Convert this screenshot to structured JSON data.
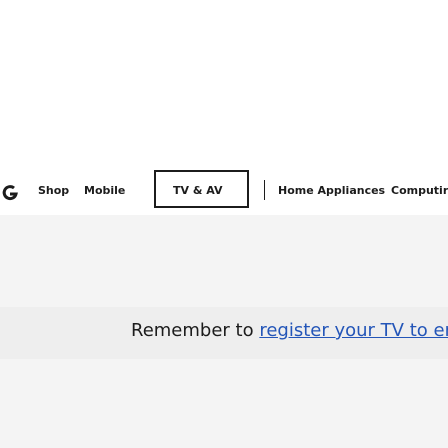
{
  "nav": {
    "logo_icon": "g-logo-icon",
    "items": [
      {
        "label": "Shop",
        "selected": false
      },
      {
        "label": "Mobile",
        "selected": false
      },
      {
        "label": "TV & AV",
        "selected": true
      },
      {
        "label": "Home Appliances",
        "selected": false
      },
      {
        "label": "Computir",
        "selected": false
      }
    ]
  },
  "reminder": {
    "prefix": "Remember to ",
    "link_text": "register your TV to enj"
  },
  "colors": {
    "text": "#1c1c1c",
    "link": "#2355b8",
    "lower_background": "#f4f4f4",
    "reminder_background": "#eeeeee"
  }
}
